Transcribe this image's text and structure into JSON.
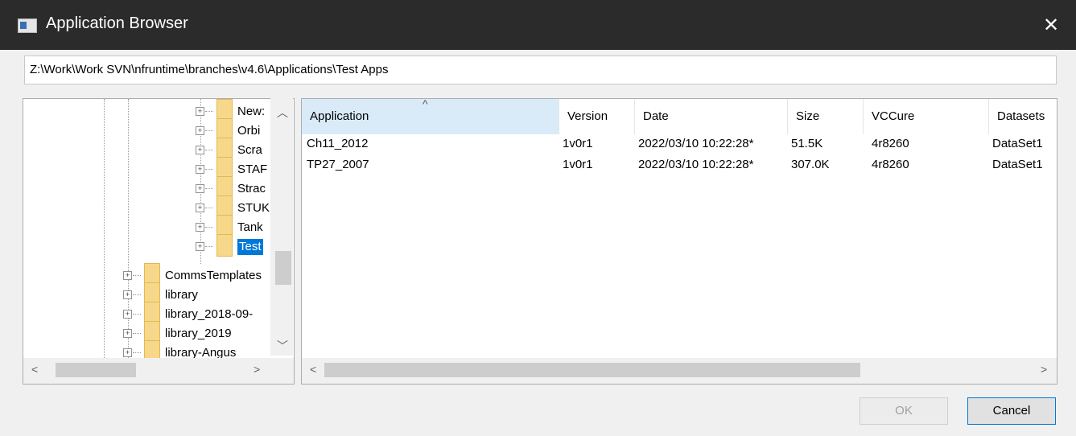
{
  "window": {
    "title": "Application Browser",
    "close_glyph": "✕"
  },
  "path": {
    "value": "Z:\\Work\\Work SVN\\nfruntime\\branches\\v4.6\\Applications\\Test Apps"
  },
  "tree": {
    "children": [
      {
        "label": "News",
        "display": "New:"
      },
      {
        "label": "Orbit",
        "display": "Orbi"
      },
      {
        "label": "Scratch",
        "display": "Scra"
      },
      {
        "label": "STAR",
        "display": "STAF"
      },
      {
        "label": "Strad",
        "display": "Strac"
      },
      {
        "label": "STUK",
        "display": "STUK"
      },
      {
        "label": "Tank",
        "display": "Tank"
      },
      {
        "label": "Test Apps",
        "display": "Test"
      }
    ],
    "siblings": [
      {
        "display": "CommsTemplates"
      },
      {
        "display": "library"
      },
      {
        "display": "library_2018-09-"
      },
      {
        "display": "library_2019"
      },
      {
        "display": "library-Angus"
      }
    ]
  },
  "list": {
    "columns": [
      "Application",
      "Version",
      "Date",
      "Size",
      "VCCure",
      "Datasets"
    ],
    "rows": [
      {
        "application": "Ch11_2012",
        "version": "1v0r1",
        "date": "2022/03/10 10:22:28*",
        "size": "51.5K",
        "vccure": "4r8260",
        "datasets": "DataSet1"
      },
      {
        "application": "TP27_2007",
        "version": "1v0r1",
        "date": "2022/03/10 10:22:28*",
        "size": "307.0K",
        "vccure": "4r8260",
        "datasets": "DataSet1"
      }
    ]
  },
  "buttons": {
    "ok": "OK",
    "cancel": "Cancel"
  },
  "icons": {
    "window_icon": "window-icon",
    "folder": "folder-icon",
    "expand": "plus-box-icon"
  },
  "colors": {
    "titlebar": "#2b2b2b",
    "selection": "#0078d7",
    "sorted_header": "#d9ebf9",
    "folder": "#f7d88a"
  }
}
